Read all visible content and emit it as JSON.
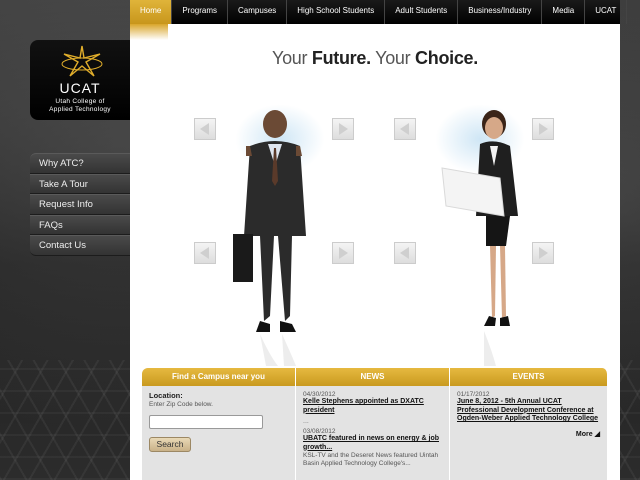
{
  "topnav": {
    "items": [
      {
        "label": "Home",
        "active": true
      },
      {
        "label": "Programs",
        "active": false
      },
      {
        "label": "Campuses",
        "active": false
      },
      {
        "label": "High School Students",
        "active": false
      },
      {
        "label": "Adult Students",
        "active": false
      },
      {
        "label": "Business/Industry",
        "active": false
      },
      {
        "label": "Media",
        "active": false
      },
      {
        "label": "UCAT",
        "active": false
      }
    ]
  },
  "logo": {
    "name": "UCAT",
    "subtitle_line1": "Utah College of",
    "subtitle_line2": "Applied Technology"
  },
  "sidenav": {
    "items": [
      "Why ATC?",
      "Take A Tour",
      "Request Info",
      "FAQs",
      "Contact Us"
    ]
  },
  "hero": {
    "tagline_part1": "Your ",
    "tagline_part2": "Future.",
    "tagline_part3": " Your ",
    "tagline_part4": "Choice."
  },
  "campus": {
    "heading": "Find a Campus near you",
    "location_label": "Location:",
    "hint": "Enter Zip Code below.",
    "zip_placeholder": "",
    "search_label": "Search"
  },
  "news": {
    "heading": "NEWS",
    "items": [
      {
        "date": "04/30/2012",
        "headline": "Kelle Stephens appointed as DXATC president",
        "snippet": "..."
      },
      {
        "date": "03/08/2012",
        "headline": "UBATC featured in news on energy & job growth...",
        "snippet": "KSL-TV and the Deseret News featured Uintah Basin Applied Technology College's..."
      }
    ]
  },
  "events": {
    "heading": "EVENTS",
    "items": [
      {
        "date": "01/17/2012",
        "headline": "June 8, 2012 - 5th Annual UCAT Professional Development Conference at Ogden-Weber Applied Technology College"
      }
    ],
    "more_label": "More"
  },
  "colors": {
    "accent_gold": "#d9a52a",
    "nav_black": "#000000",
    "panel_gray": "#e3e3e3"
  }
}
